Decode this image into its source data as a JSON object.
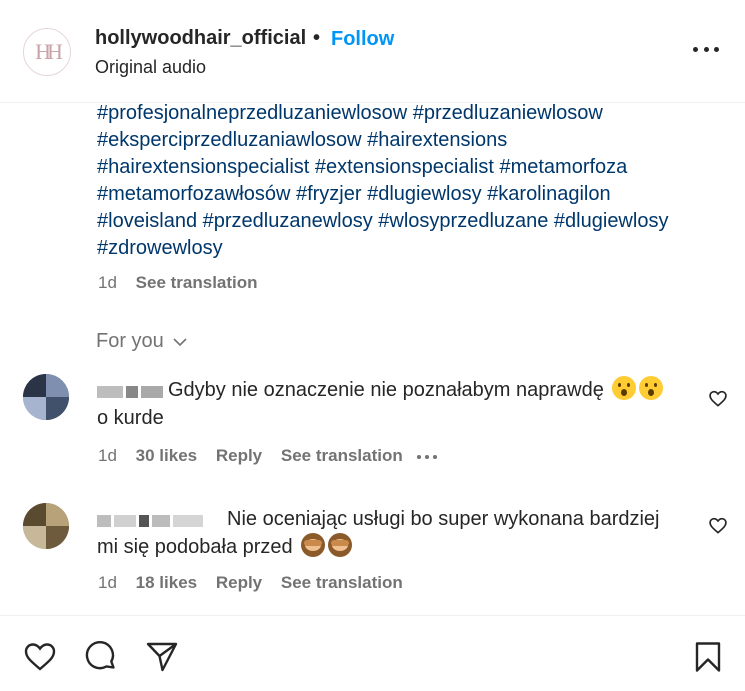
{
  "post": {
    "username": "hollywoodhair_official",
    "separator": "•",
    "follow_label": "Follow",
    "subtitle": "Original audio",
    "logo_text": "HH"
  },
  "caption": {
    "lines": [
      "#profesjonalneprzedluzaniewlosow #przedluzaniewlosow",
      "#eksperciprzedluzaniawlosow #hairextensions",
      "#hairextensionspecialist #extensionspecialist #metamorfoza",
      "#metamorfozawłosów #fryzjer #dlugiewlosy #karolinagilon",
      "#loveisland #przedluzanewlosy #wlosyprzedluzane #dlugiewlosy",
      "#zdrowewlosy"
    ],
    "time": "1d",
    "see_translation": "See translation"
  },
  "for_you": {
    "label": "For you"
  },
  "comments": [
    {
      "text_line1": "Gdyby nie oznaczenie nie poznałabym naprawdę",
      "text_line2": "o kurde",
      "emoji": [
        "hushed-face-emoji",
        "hushed-face-emoji"
      ],
      "time": "1d",
      "likes": "30 likes",
      "reply": "Reply",
      "see_translation": "See translation"
    },
    {
      "text_line1": "Nie oceniając usługi bo super wykonana bardziej",
      "text_line2": "mi się podobała przed",
      "emoji": [
        "see-no-evil-monkey-emoji",
        "see-no-evil-monkey-emoji"
      ],
      "time": "1d",
      "likes": "18 likes",
      "reply": "Reply",
      "see_translation": "See translation"
    }
  ],
  "colors": {
    "hashtag": "#00376b",
    "follow": "#0095f6",
    "muted": "#737373",
    "text": "#262626"
  }
}
